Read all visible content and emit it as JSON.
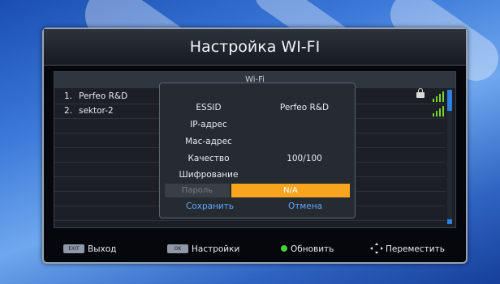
{
  "window": {
    "title": "Настройка WI-FI"
  },
  "list": {
    "header": "Wi-Fi",
    "networks": [
      {
        "num": "1.",
        "ssid": "Perfeo R&D",
        "locked": true,
        "signal_bars": 4
      },
      {
        "num": "2.",
        "ssid": "sektor-2",
        "locked": false,
        "signal_bars": 4
      }
    ]
  },
  "dialog": {
    "fields": [
      {
        "label": "ESSID",
        "value": "Perfeo R&D"
      },
      {
        "label": "IP-адрес",
        "value": ""
      },
      {
        "label": "Mac-адрес",
        "value": ""
      },
      {
        "label": "Качество",
        "value": "100/100"
      },
      {
        "label": "Шифрование",
        "value": ""
      }
    ],
    "password_label": "Пароль",
    "password_value": "N/A",
    "save_label": "Сохранить",
    "cancel_label": "Отмена"
  },
  "footer": {
    "exit_key": "EXIT",
    "exit_label": "Выход",
    "ok_key": "OK",
    "settings_label": "Настройки",
    "refresh_label": "Обновить",
    "move_label": "Переместить"
  },
  "colors": {
    "highlight": "#f7a41f",
    "signal": "#7ad22c",
    "accent_blue": "#2d7fe0",
    "button_text": "#5fa8ff",
    "green_key": "#46d13a"
  },
  "icons": [
    "lock-icon",
    "signal-bars-icon",
    "green-dot-icon",
    "navigation-arrows-icon"
  ]
}
